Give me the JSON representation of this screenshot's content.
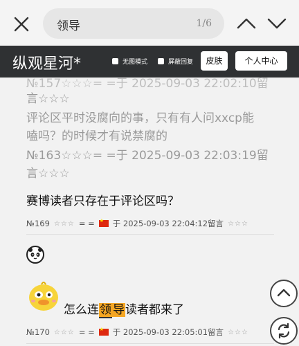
{
  "findbar": {
    "query": "领导",
    "count": "1/6"
  },
  "header": {
    "title": "纵观星河*",
    "option_no_image": "无图模式",
    "option_block_reply": "屏蔽回复",
    "skin_button": "皮肤",
    "user_center_button": "个人中心"
  },
  "quote": {
    "line0": "№157☆☆☆= =于 2025-09-03 22:02:10留",
    "line1": "言☆☆☆",
    "line2": "评论区平时没腐向的事，只有有人问xxcp能",
    "line3": "嗑吗？的时候才有说禁腐的",
    "line4": "№163☆☆☆= =于 2025-09-03 22:03:19留",
    "line5": "言☆☆☆"
  },
  "comments": [
    {
      "text": "赛博读者只存在于评论区吗？",
      "meta_num": "№169",
      "meta_stars": "☆☆☆",
      "meta_sep": "= =",
      "meta_time": "于 2025-09-03 22:04:12留言",
      "meta_stars2": "☆☆☆"
    },
    {
      "text_pre": "怎么连",
      "text_hl_a": "领",
      "text_hl_b": "导",
      "text_post": "读者都来了",
      "meta_num": "№170",
      "meta_stars": "☆☆☆",
      "meta_sep": "= =",
      "meta_time": "于 2025-09-03 22:05:01留言",
      "meta_stars2": "☆☆☆"
    }
  ],
  "icons": {
    "close": "close-icon",
    "prev": "chevron-up-icon",
    "next": "chevron-down-icon",
    "up": "scroll-up-icon",
    "refresh": "refresh-icon"
  },
  "colors": {
    "header_bg": "#2f3133",
    "highlight": "#f5a623"
  }
}
